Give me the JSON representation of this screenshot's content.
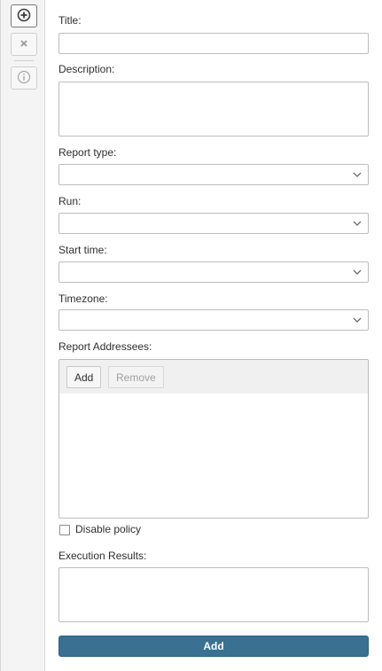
{
  "toolbar": {
    "items": [
      {
        "icon": "plus-circle-icon",
        "active": true
      },
      {
        "icon": "close-icon",
        "active": false
      },
      {
        "icon": "info-icon",
        "active": false
      }
    ]
  },
  "form": {
    "title_label": "Title:",
    "title_value": "",
    "description_label": "Description:",
    "description_value": "",
    "report_type_label": "Report type:",
    "report_type_value": "",
    "run_label": "Run:",
    "run_value": "",
    "start_time_label": "Start time:",
    "start_time_value": "",
    "timezone_label": "Timezone:",
    "timezone_value": "",
    "addressees_label": "Report Addressees:",
    "addressees_add": "Add",
    "addressees_remove": "Remove",
    "addressees": [],
    "disable_policy_label": "Disable policy",
    "disable_policy_checked": false,
    "execution_results_label": "Execution Results:",
    "execution_results_value": "",
    "submit_label": "Add"
  },
  "colors": {
    "accent": "#3a7192",
    "toolbar_bg": "#f4f4f4",
    "border": "#bdbdbd"
  }
}
